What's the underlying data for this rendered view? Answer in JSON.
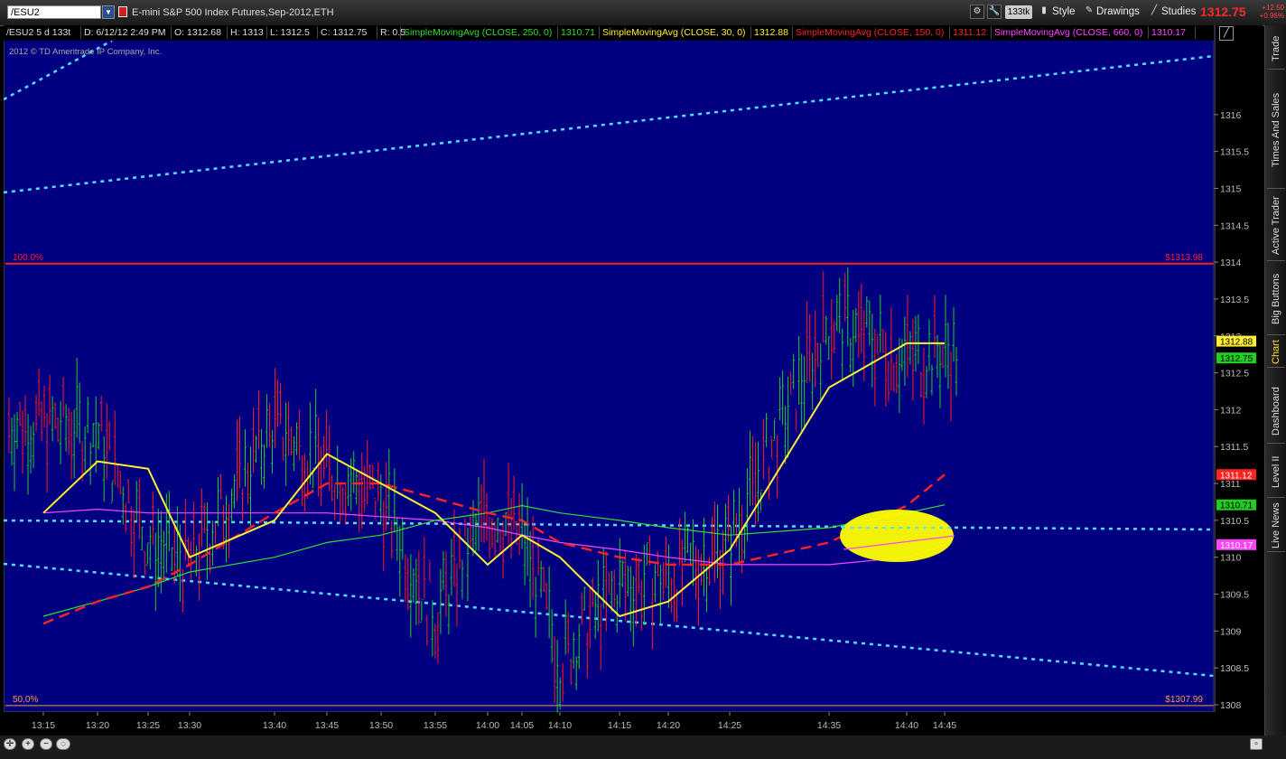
{
  "toolbar": {
    "symbol_value": "/ESU2",
    "description": "E-mini S&P 500 Index Futures,Sep-2012,ETH",
    "aggregation": "133tk",
    "style_label": "Style",
    "drawings_label": "Drawings",
    "studies_label": "Studies",
    "last_price": "1312.75",
    "net_change": "+12.50",
    "pct_change": "+0.96%"
  },
  "chart_header": {
    "symbol_agg": "/ESU2 5 d 133t",
    "date": "D: 6/12/12 2:49 PM",
    "open": "O: 1312.68",
    "high": "H: 1313",
    "low": "L: 1312.5",
    "close": "C: 1312.75",
    "range": "R: 0.5",
    "sma250_label": "SimpleMovingAvg (CLOSE, 250, 0)",
    "sma250_val": "1310.71",
    "sma30_label": "SimpleMovingAvg (CLOSE, 30, 0)",
    "sma30_val": "1312.88",
    "sma150_label": "SimpleMovingAvg (CLOSE, 150, 0)",
    "sma150_val": "1311.12",
    "sma660_label": "SimpleMovingAvg (CLOSE, 660, 0)",
    "sma660_val": "1310.17"
  },
  "copyright": "2012 © TD Ameritrade IP Company, Inc.",
  "colors": {
    "background": "#000080",
    "up_bar": "#22cc22",
    "down_bar": "#ff1a1a",
    "sma30": "#ffee33",
    "sma150": "#ff2222",
    "sma250": "#33dd33",
    "sma660": "#ff44ff",
    "trendline": "#55ddff",
    "fib": "#ff2020",
    "highlight": "#ffff00"
  },
  "fib_levels": [
    {
      "pct": "100.0%",
      "price_label": "$1313.98",
      "price": 1313.98
    },
    {
      "pct": "50.0%",
      "price_label": "$1307.99",
      "price": 1307.99
    }
  ],
  "price_axis": {
    "min": 1308,
    "max": 1316.5,
    "ticks": [
      "1316",
      "1315.5",
      "1315",
      "1314.5",
      "1314",
      "1313.5",
      "1313",
      "1312.5",
      "1312",
      "1311.5",
      "1311",
      "1310.5",
      "1310",
      "1309.5",
      "1309",
      "1308.5",
      "1308"
    ],
    "tag_values": [
      "1312.88",
      "1312.75",
      "1311.12",
      "1310.71",
      "1310.17"
    ]
  },
  "time_axis": {
    "labels": [
      "13:15",
      "13:20",
      "13:25",
      "13:30",
      "13:40",
      "13:45",
      "13:50",
      "13:55",
      "14:00",
      "14:05",
      "14:10",
      "14:15",
      "14:20",
      "14:25",
      "14:35",
      "14:40",
      "14:45"
    ]
  },
  "side_tabs": [
    "Trade",
    "Times And Sales",
    "Active Trader",
    "Big Buttons",
    "Chart",
    "Dashboard",
    "Level II",
    "Live News"
  ],
  "active_tab": "Chart",
  "chart_data": {
    "type": "line",
    "title": "",
    "xlabel": "",
    "ylabel": "",
    "ylim": [
      1308,
      1316.5
    ],
    "x": [
      "13:15",
      "13:20",
      "13:25",
      "13:30",
      "13:40",
      "13:45",
      "13:50",
      "13:55",
      "14:00",
      "14:05",
      "14:10",
      "14:15",
      "14:20",
      "14:25",
      "14:35",
      "14:40",
      "14:45"
    ],
    "series": [
      {
        "name": "SimpleMovingAvg (CLOSE, 30, 0)",
        "values": [
          1310.6,
          1311.3,
          1311.2,
          1310.0,
          1310.5,
          1311.4,
          1311.0,
          1310.6,
          1309.9,
          1310.3,
          1310.0,
          1309.2,
          1309.4,
          1310.1,
          1312.3,
          1312.9,
          1312.9
        ]
      },
      {
        "name": "SimpleMovingAvg (CLOSE, 150, 0)",
        "values": [
          1309.1,
          1309.4,
          1309.6,
          1309.9,
          1310.6,
          1311.0,
          1311.0,
          1310.8,
          1310.6,
          1310.5,
          1310.2,
          1310.0,
          1309.9,
          1309.9,
          1310.2,
          1310.7,
          1311.12
        ]
      },
      {
        "name": "SimpleMovingAvg (CLOSE, 250, 0)",
        "values": [
          1309.2,
          1309.4,
          1309.6,
          1309.8,
          1310.0,
          1310.2,
          1310.3,
          1310.5,
          1310.6,
          1310.7,
          1310.6,
          1310.5,
          1310.4,
          1310.3,
          1310.4,
          1310.6,
          1310.71
        ]
      },
      {
        "name": "SimpleMovingAvg (CLOSE, 660, 0)",
        "values": [
          1310.6,
          1310.65,
          1310.6,
          1310.6,
          1310.6,
          1310.6,
          1310.55,
          1310.5,
          1310.4,
          1310.3,
          1310.2,
          1310.1,
          1310.0,
          1309.9,
          1309.9,
          1310.0,
          1310.17
        ]
      },
      {
        "name": "Close",
        "values": [
          1311.8,
          1311.7,
          1310.2,
          1309.9,
          1311.8,
          1311.2,
          1310.8,
          1309.2,
          1310.6,
          1310.3,
          1308.6,
          1309.6,
          1309.7,
          1310.2,
          1313.2,
          1312.7,
          1312.75
        ]
      }
    ]
  }
}
